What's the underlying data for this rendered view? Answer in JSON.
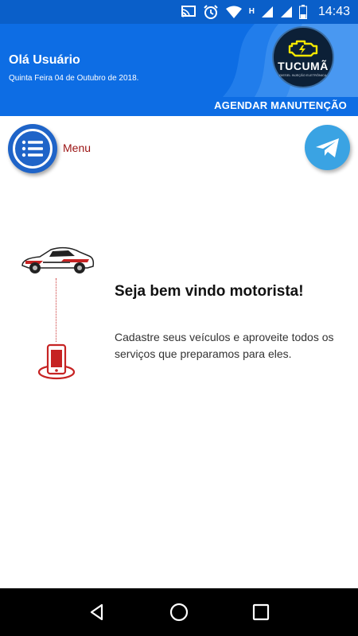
{
  "status_bar": {
    "time": "14:43",
    "network_letter": "H"
  },
  "header": {
    "greeting": "Olá Usuário",
    "date": "Quinta Feira 04 de Outubro de 2018.",
    "logo": {
      "name": "TUCUMÃ",
      "subtitle": "DIESEL INJEÇÃO ELETRÔNICA"
    },
    "schedule_link": "AGENDAR MANUTENÇÃO"
  },
  "menu": {
    "label": "Menu"
  },
  "welcome": {
    "title": "Seja bem vindo motorista!",
    "text": "Cadastre seus veículos e aproveite todos os serviços que preparamos para eles."
  },
  "colors": {
    "header_blue": "#0d6de4",
    "status_blue": "#0a5fc9",
    "accent_red": "#9a1212",
    "telegram_blue": "#3aa3e3"
  },
  "icons": {
    "status": [
      "cast-icon",
      "alarm-icon",
      "wifi-icon",
      "signal-icon",
      "signal-icon",
      "battery-icon"
    ],
    "menu": "list-icon",
    "share": "telegram-icon",
    "nav": [
      "back-icon",
      "home-icon",
      "recents-icon"
    ]
  }
}
